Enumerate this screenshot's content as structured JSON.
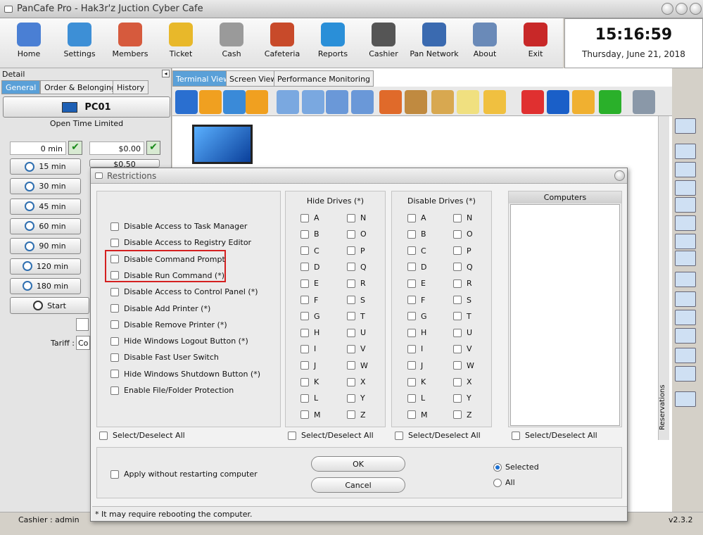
{
  "app": {
    "title": "PanCafe Pro - Hak3r'z Juction Cyber Cafe",
    "version": "v2.3.2"
  },
  "toolbar": [
    {
      "label": "Home",
      "icon": "network-icon",
      "color": "#4a7fd4"
    },
    {
      "label": "Settings",
      "icon": "gear-icon",
      "color": "#3d8fd6"
    },
    {
      "label": "Members",
      "icon": "members-icon",
      "color": "#d65a3d"
    },
    {
      "label": "Ticket",
      "icon": "ticket-icon",
      "color": "#e8b82a"
    },
    {
      "label": "Cash",
      "icon": "cash-register-icon",
      "color": "#9a9a9a"
    },
    {
      "label": "Cafeteria",
      "icon": "shop-icon",
      "color": "#c84a2a"
    },
    {
      "label": "Reports",
      "icon": "chart-icon",
      "color": "#2a8fd8"
    },
    {
      "label": "Cashier",
      "icon": "person-icon",
      "color": "#555555"
    },
    {
      "label": "Pan Network",
      "icon": "globe-icon",
      "color": "#3a6ab0"
    },
    {
      "label": "About",
      "icon": "info-icon",
      "color": "#6a8ab8"
    },
    {
      "label": "Exit",
      "icon": "exit-icon",
      "color": "#c82828"
    }
  ],
  "clock": {
    "time": "15:16:59",
    "date": "Thursday, June 21, 2018"
  },
  "left": {
    "detail": "Detail",
    "tabs": [
      "General",
      "Order & Belonging",
      "History"
    ],
    "pc": "PC01",
    "mode": "Open Time Limited",
    "min_value": "0 min",
    "money_value": "$0.00",
    "price_partial": "$0.50",
    "presets": [
      "15 min",
      "30 min",
      "45 min",
      "60 min",
      "90 min",
      "120 min",
      "180 min"
    ],
    "start": "Start",
    "tariff": "Tariff :",
    "tariff_value": "Co"
  },
  "main": {
    "tabs": [
      "Terminal View",
      "Screen View",
      "Performance Monitoring"
    ],
    "reservations": "Reservations"
  },
  "dialog": {
    "title": "Restrictions",
    "restrictions": [
      "Disable Access to Task Manager",
      "Disable Access to Registry Editor",
      "Disable Command Prompt",
      "Disable Run Command (*)",
      "Disable Access to Control Panel (*)",
      "Disable Add Printer (*)",
      "Disable Remove Printer (*)",
      "Hide Windows Logout Button (*)",
      "Disable Fast User Switch",
      "Hide Windows Shutdown Button (*)",
      "Enable File/Folder Protection"
    ],
    "hide_drives_title": "Hide Drives (*)",
    "disable_drives_title": "Disable Drives (*)",
    "drives_left": [
      "A",
      "B",
      "C",
      "D",
      "E",
      "F",
      "G",
      "H",
      "I",
      "J",
      "K",
      "L",
      "M"
    ],
    "drives_right": [
      "N",
      "O",
      "P",
      "Q",
      "R",
      "S",
      "T",
      "U",
      "V",
      "W",
      "X",
      "Y",
      "Z"
    ],
    "computers_title": "Computers",
    "select_all": "Select/Deselect All",
    "apply_label": "Apply without restarting computer",
    "ok": "OK",
    "cancel": "Cancel",
    "radio_selected": "Selected",
    "radio_all": "All",
    "note": "* It may require rebooting the computer.",
    "highlight_color": "#d42020"
  },
  "status": {
    "user": "Cashier : admin"
  }
}
